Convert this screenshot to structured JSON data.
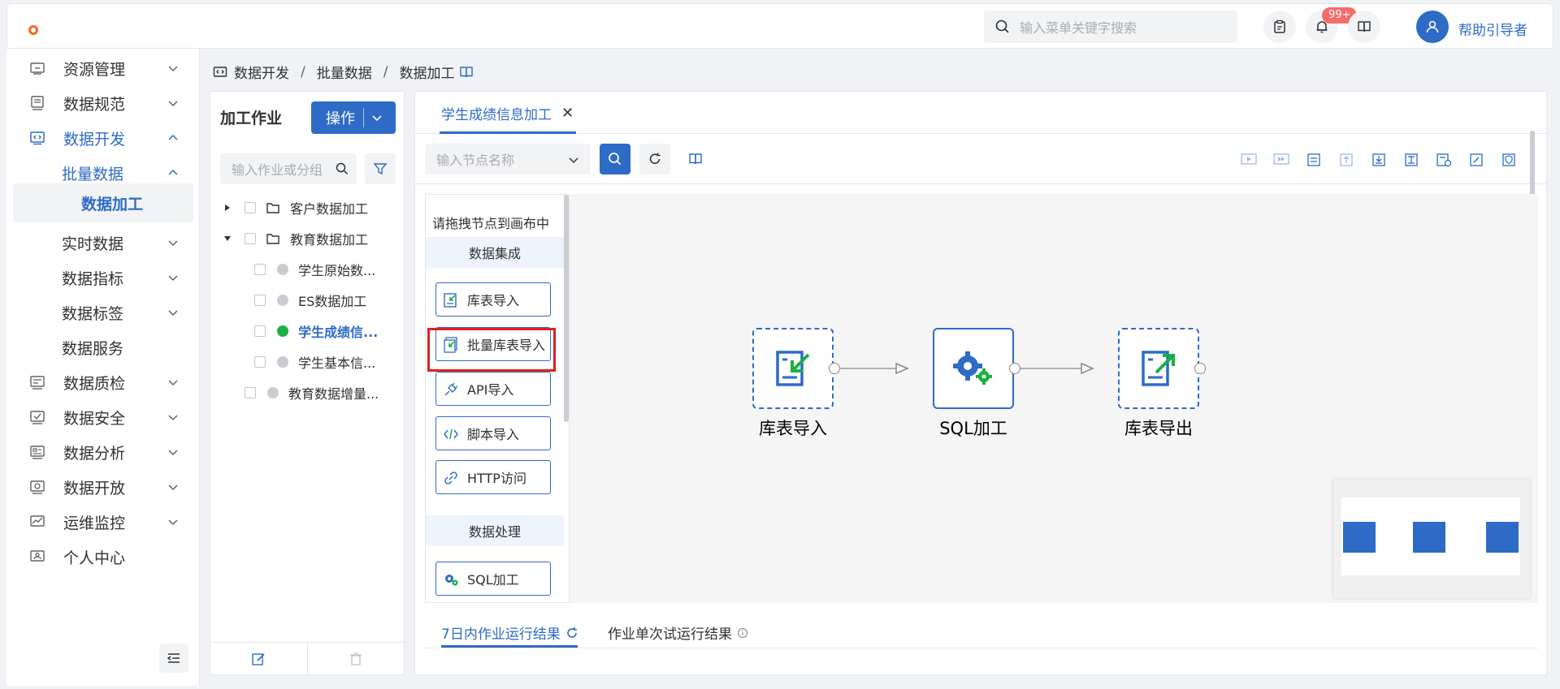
{
  "header": {
    "search_placeholder": "输入菜单关键字搜索",
    "notification_badge": "99+",
    "help_label": "帮助引导者"
  },
  "sidebar": {
    "items": [
      {
        "label": "资源管理"
      },
      {
        "label": "数据规范"
      },
      {
        "label": "数据开发"
      },
      {
        "label": "批量数据"
      },
      {
        "label": "数据加工"
      },
      {
        "label": "实时数据"
      },
      {
        "label": "数据指标"
      },
      {
        "label": "数据标签"
      },
      {
        "label": "数据服务"
      },
      {
        "label": "数据质检"
      },
      {
        "label": "数据安全"
      },
      {
        "label": "数据分析"
      },
      {
        "label": "数据开放"
      },
      {
        "label": "运维监控"
      },
      {
        "label": "个人中心"
      }
    ]
  },
  "breadcrumb": {
    "level1": "数据开发",
    "level2": "批量数据",
    "level3": "数据加工",
    "separator": "/"
  },
  "job_panel": {
    "title": "加工作业",
    "operate_label": "操作",
    "search_placeholder": "输入作业或分组",
    "tree": [
      {
        "name": "客户数据加工"
      },
      {
        "name": "教育数据加工"
      },
      {
        "name": "学生原始数..."
      },
      {
        "name": "ES数据加工"
      },
      {
        "name": "学生成绩信..."
      },
      {
        "name": "学生基本信..."
      },
      {
        "name": "教育数据增量..."
      }
    ]
  },
  "main": {
    "tab_label": "学生成绩信息加工",
    "tab_close": "✕",
    "node_search_placeholder": "输入节点名称",
    "palette": {
      "hint": "请拖拽节点到画布中",
      "group1": "数据集成",
      "group2": "数据处理",
      "items": [
        {
          "label": "库表导入"
        },
        {
          "label": "批量库表导入"
        },
        {
          "label": "API导入"
        },
        {
          "label": "脚本导入"
        },
        {
          "label": "HTTP访问"
        },
        {
          "label": "SQL加工"
        }
      ]
    },
    "flow": {
      "nodes": [
        {
          "label": "库表导入"
        },
        {
          "label": "SQL加工"
        },
        {
          "label": "库表导出"
        }
      ]
    },
    "result_tabs": {
      "active": "7日内作业运行结果",
      "other": "作业单次试运行结果"
    }
  },
  "colors": {
    "primary": "#2d6bc7",
    "accent_orange": "#f26b1d",
    "success": "#1ab042",
    "danger": "#e02020"
  }
}
